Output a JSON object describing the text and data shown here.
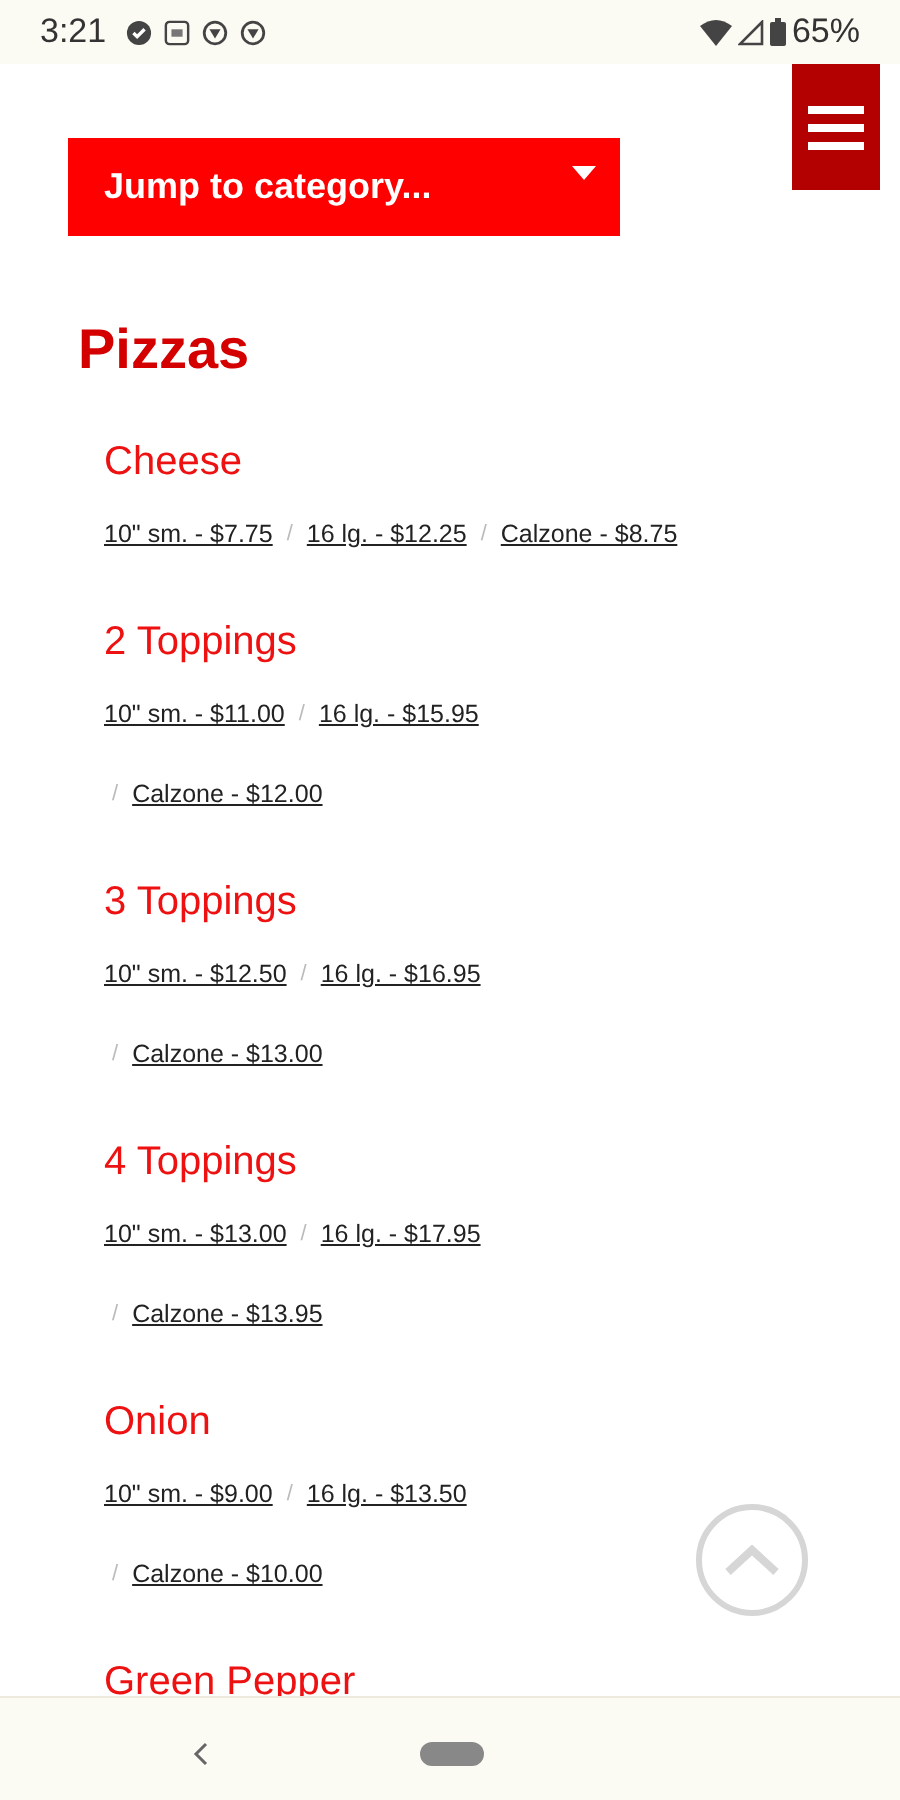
{
  "status_bar": {
    "time": "3:21",
    "battery": "65%"
  },
  "jump_menu": {
    "label": "Jump to category..."
  },
  "section": {
    "title": "Pizzas"
  },
  "items": [
    {
      "name": "Cheese",
      "lines": [
        [
          {
            "label": "10\" sm. - $7.75"
          },
          {
            "separator": "/",
            "label": "16 lg. - $12.25"
          },
          {
            "separator": "/",
            "label": "Calzone - $8.75"
          }
        ]
      ]
    },
    {
      "name": "2 Toppings",
      "lines": [
        [
          {
            "label": "10\" sm. - $11.00"
          },
          {
            "separator": "/",
            "label": "16 lg. - $15.95"
          }
        ],
        [
          {
            "separator": "/",
            "label": "Calzone - $12.00"
          }
        ]
      ]
    },
    {
      "name": "3 Toppings",
      "lines": [
        [
          {
            "label": "10\" sm. - $12.50"
          },
          {
            "separator": "/",
            "label": "16 lg. - $16.95"
          }
        ],
        [
          {
            "separator": "/",
            "label": "Calzone - $13.00"
          }
        ]
      ]
    },
    {
      "name": "4 Toppings",
      "lines": [
        [
          {
            "label": "10\" sm. - $13.00"
          },
          {
            "separator": "/",
            "label": "16 lg. - $17.95"
          }
        ],
        [
          {
            "separator": "/",
            "label": "Calzone - $13.95"
          }
        ]
      ]
    },
    {
      "name": "Onion",
      "lines": [
        [
          {
            "label": "10\" sm. - $9.00"
          },
          {
            "separator": "/",
            "label": "16 lg. - $13.50"
          }
        ],
        [
          {
            "separator": "/",
            "label": "Calzone - $10.00"
          }
        ]
      ]
    },
    {
      "name": "Green Pepper"
    }
  ]
}
